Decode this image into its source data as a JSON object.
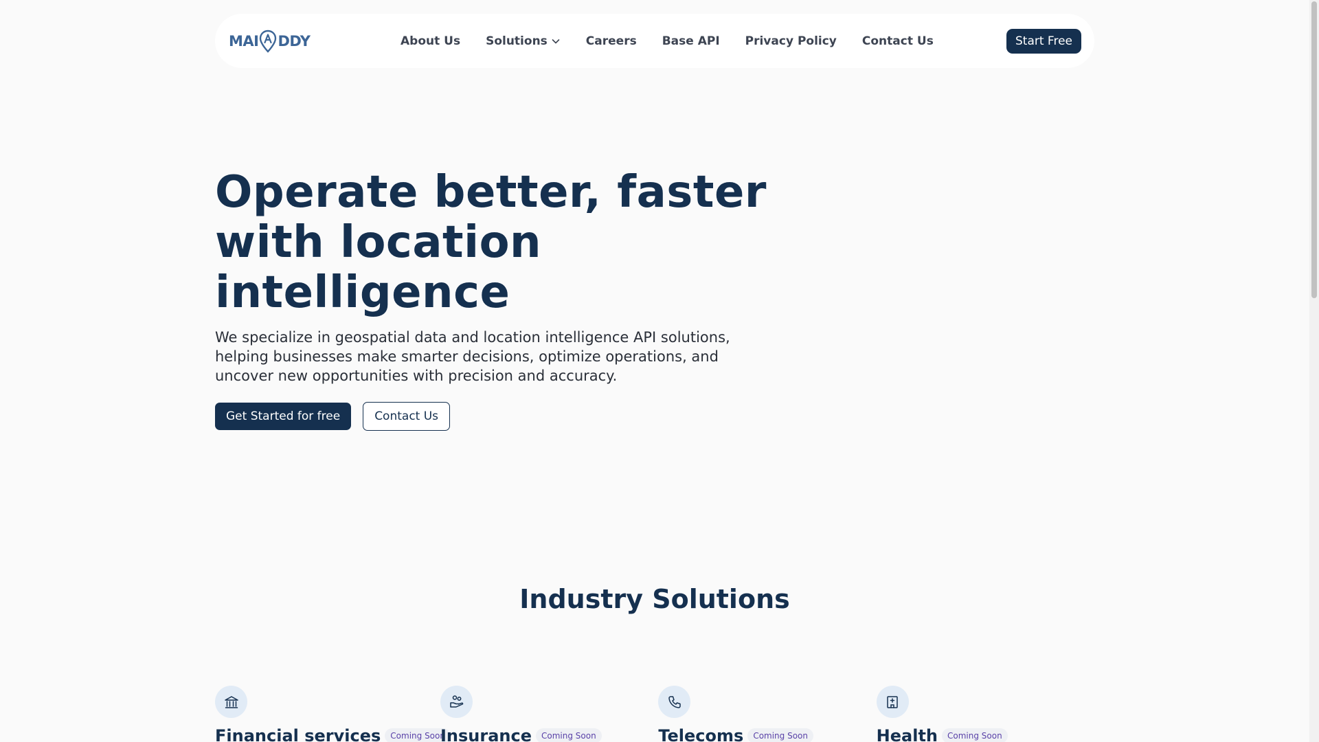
{
  "brand": {
    "logo_text_left": "MAI",
    "logo_text_right": "DDY",
    "accent": "#3c6596",
    "primary": "#15304f"
  },
  "nav": {
    "links": [
      {
        "label": "About Us"
      },
      {
        "label": "Solutions",
        "has_dropdown": true
      },
      {
        "label": "Careers"
      },
      {
        "label": "Base API"
      },
      {
        "label": "Privacy Policy"
      },
      {
        "label": "Contact Us"
      }
    ],
    "cta_label": "Start Free"
  },
  "hero": {
    "title": "Operate better, faster with location intelligence",
    "description": "We specialize in geospatial data and location intelligence API solutions, helping businesses make smarter decisions, optimize operations, and uncover new opportunities with precision and accuracy.",
    "primary_cta": "Get Started for free",
    "secondary_cta": "Contact Us"
  },
  "industry": {
    "title": "Industry Solutions",
    "items": [
      {
        "name": "Financial services",
        "badge": "Coming Soon",
        "icon": "bank-icon"
      },
      {
        "name": "Insurance",
        "badge": "Coming Soon",
        "icon": "hand-coins-icon"
      },
      {
        "name": "Telecoms",
        "badge": "Coming Soon",
        "icon": "phone-icon"
      },
      {
        "name": "Health",
        "badge": "Coming Soon",
        "icon": "hospital-icon"
      }
    ]
  }
}
